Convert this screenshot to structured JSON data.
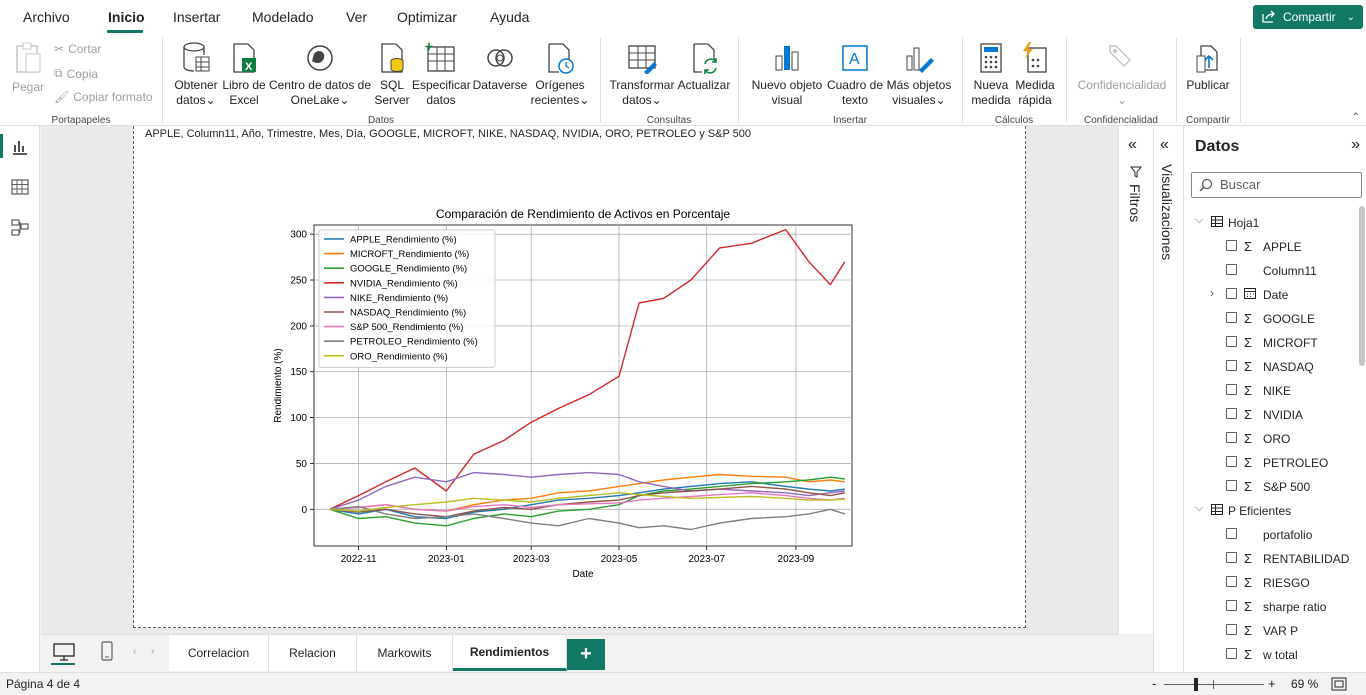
{
  "menu": {
    "items": [
      "Archivo",
      "Inicio",
      "Insertar",
      "Modelado",
      "Ver",
      "Optimizar",
      "Ayuda"
    ],
    "active": "Inicio",
    "share_label": "Compartir"
  },
  "ribbon": {
    "clipboard": {
      "paste": "Pegar",
      "cut": "Cortar",
      "copy": "Copia",
      "format_painter": "Copiar formato",
      "group": "Portapapeles"
    },
    "data": {
      "get_data_1": "Obtener",
      "get_data_2": "datos",
      "excel_1": "Libro de",
      "excel_2": "Excel",
      "onelake_1": "Centro de datos de",
      "onelake_2": "OneLake",
      "sql_1": "SQL",
      "sql_2": "Server",
      "enter_1": "Especificar",
      "enter_2": "datos",
      "dataverse": "Dataverse",
      "recent_1": "Orígenes",
      "recent_2": "recientes",
      "group": "Datos"
    },
    "queries": {
      "transform_1": "Transformar",
      "transform_2": "datos",
      "refresh": "Actualizar",
      "group": "Consultas"
    },
    "insert": {
      "visual_1": "Nuevo objeto",
      "visual_2": "visual",
      "textbox_1": "Cuadro de",
      "textbox_2": "texto",
      "more_1": "Más objetos",
      "more_2": "visuales",
      "group": "Insertar"
    },
    "calc": {
      "measure_1": "Nueva",
      "measure_2": "medida",
      "quick_1": "Medida",
      "quick_2": "rápida",
      "group": "Cálculos"
    },
    "sensitivity": {
      "label": "Confidencialidad",
      "group": "Confidencialidad"
    },
    "share": {
      "publish": "Publicar",
      "group": "Compartir"
    }
  },
  "visual": {
    "header": "APPLE, Column11, Año, Trimestre, Mes, Día, GOOGLE, MICROFT, NIKE, NASDAQ, NVIDIA, ORO, PETROLEO y S&P 500"
  },
  "chart_data": {
    "type": "line",
    "title": "Comparación de Rendimiento de Activos en Porcentaje",
    "xlabel": "Date",
    "ylabel": "Rendimiento (%)",
    "xlim": [
      "2022-10-01",
      "2023-10-10"
    ],
    "ylim": [
      -40,
      310
    ],
    "xticks": [
      "2022-11",
      "2023-01",
      "2023-03",
      "2023-05",
      "2023-07",
      "2023-09"
    ],
    "yticks": [
      0,
      50,
      100,
      150,
      200,
      250,
      300
    ],
    "grid": true,
    "legend_position": "upper-left",
    "x": [
      "2022-10-12",
      "2022-11-01",
      "2022-11-20",
      "2022-12-10",
      "2023-01-01",
      "2023-01-20",
      "2023-02-10",
      "2023-03-01",
      "2023-03-20",
      "2023-04-10",
      "2023-05-01",
      "2023-05-15",
      "2023-06-01",
      "2023-06-20",
      "2023-07-10",
      "2023-08-01",
      "2023-08-25",
      "2023-09-10",
      "2023-09-25",
      "2023-10-05"
    ],
    "series": [
      {
        "name": "APPLE_Rendimiento (%)",
        "color": "#1f77b4",
        "values": [
          0,
          -5,
          0,
          -8,
          -10,
          -3,
          0,
          5,
          10,
          12,
          15,
          18,
          22,
          25,
          28,
          30,
          25,
          22,
          20,
          22
        ]
      },
      {
        "name": "MICROFT_Rendimiento (%)",
        "color": "#ff7f0e",
        "values": [
          0,
          2,
          5,
          0,
          -2,
          5,
          10,
          12,
          18,
          20,
          25,
          28,
          32,
          35,
          38,
          36,
          35,
          30,
          32,
          30
        ]
      },
      {
        "name": "GOOGLE_Rendimiento (%)",
        "color": "#2ca02c",
        "values": [
          0,
          -10,
          -8,
          -15,
          -18,
          -10,
          -5,
          -8,
          -2,
          0,
          5,
          15,
          20,
          22,
          25,
          28,
          30,
          32,
          35,
          33
        ]
      },
      {
        "name": "NVIDIA_Rendimiento (%)",
        "color": "#d62728",
        "values": [
          0,
          15,
          30,
          45,
          20,
          60,
          75,
          95,
          110,
          125,
          145,
          225,
          230,
          250,
          285,
          290,
          305,
          270,
          245,
          270
        ]
      },
      {
        "name": "NIKE_Rendimiento (%)",
        "color": "#9467bd",
        "values": [
          0,
          10,
          25,
          35,
          30,
          40,
          38,
          35,
          38,
          40,
          38,
          30,
          25,
          20,
          22,
          20,
          18,
          15,
          18,
          20
        ]
      },
      {
        "name": "NASDAQ_Rendimiento (%)",
        "color": "#8c564b",
        "values": [
          0,
          -3,
          0,
          -5,
          -8,
          -2,
          2,
          0,
          5,
          8,
          10,
          15,
          18,
          20,
          22,
          25,
          22,
          18,
          15,
          18
        ]
      },
      {
        "name": "S&P 500_Rendimiento (%)",
        "color": "#e377c2",
        "values": [
          0,
          2,
          5,
          0,
          -2,
          3,
          5,
          2,
          5,
          6,
          7,
          10,
          12,
          14,
          16,
          18,
          15,
          12,
          10,
          12
        ]
      },
      {
        "name": "PETROLEO_Rendimiento (%)",
        "color": "#7f7f7f",
        "values": [
          0,
          3,
          -5,
          -10,
          -8,
          -5,
          -10,
          -15,
          -18,
          -10,
          -15,
          -20,
          -18,
          -22,
          -15,
          -10,
          -8,
          -5,
          0,
          -5
        ]
      },
      {
        "name": "ORO_Rendimiento (%)",
        "color": "#bcbd22",
        "values": [
          0,
          -2,
          2,
          5,
          8,
          12,
          10,
          8,
          12,
          15,
          18,
          16,
          14,
          12,
          13,
          14,
          12,
          10,
          10,
          11
        ]
      }
    ]
  },
  "panes": {
    "filters": "Filtros",
    "visualizations": "Visualizaciones",
    "data_title": "Datos",
    "search_placeholder": "Buscar"
  },
  "fields": {
    "table1": "Hoja1",
    "table1_fields": [
      {
        "name": "APPLE",
        "sigma": "Σ"
      },
      {
        "name": "Column11",
        "sigma": ""
      },
      {
        "name": "Date",
        "sigma": "cal"
      },
      {
        "name": "GOOGLE",
        "sigma": "Σ"
      },
      {
        "name": "MICROFT",
        "sigma": "Σ"
      },
      {
        "name": "NASDAQ",
        "sigma": "Σ"
      },
      {
        "name": "NIKE",
        "sigma": "Σ"
      },
      {
        "name": "NVIDIA",
        "sigma": "Σ"
      },
      {
        "name": "ORO",
        "sigma": "Σ"
      },
      {
        "name": "PETROLEO",
        "sigma": "Σ"
      },
      {
        "name": "S&P 500",
        "sigma": "Σ"
      }
    ],
    "table2": "P Eficientes",
    "table2_fields": [
      {
        "name": "portafolio",
        "sigma": ""
      },
      {
        "name": "RENTABILIDAD",
        "sigma": "Σ"
      },
      {
        "name": "RIESGO",
        "sigma": "Σ"
      },
      {
        "name": "sharpe ratio",
        "sigma": "Σ"
      },
      {
        "name": "VAR P",
        "sigma": "Σ"
      },
      {
        "name": "w total",
        "sigma": "Σ"
      }
    ]
  },
  "tabs": {
    "items": [
      "Correlacion",
      "Relacion",
      "Markowits",
      "Rendimientos"
    ],
    "active": "Rendimientos",
    "add": "+"
  },
  "status": {
    "page": "Página 4 de 4",
    "zoom": "69 %",
    "zoom_level": 0.69,
    "minus": "-",
    "plus": "+"
  }
}
